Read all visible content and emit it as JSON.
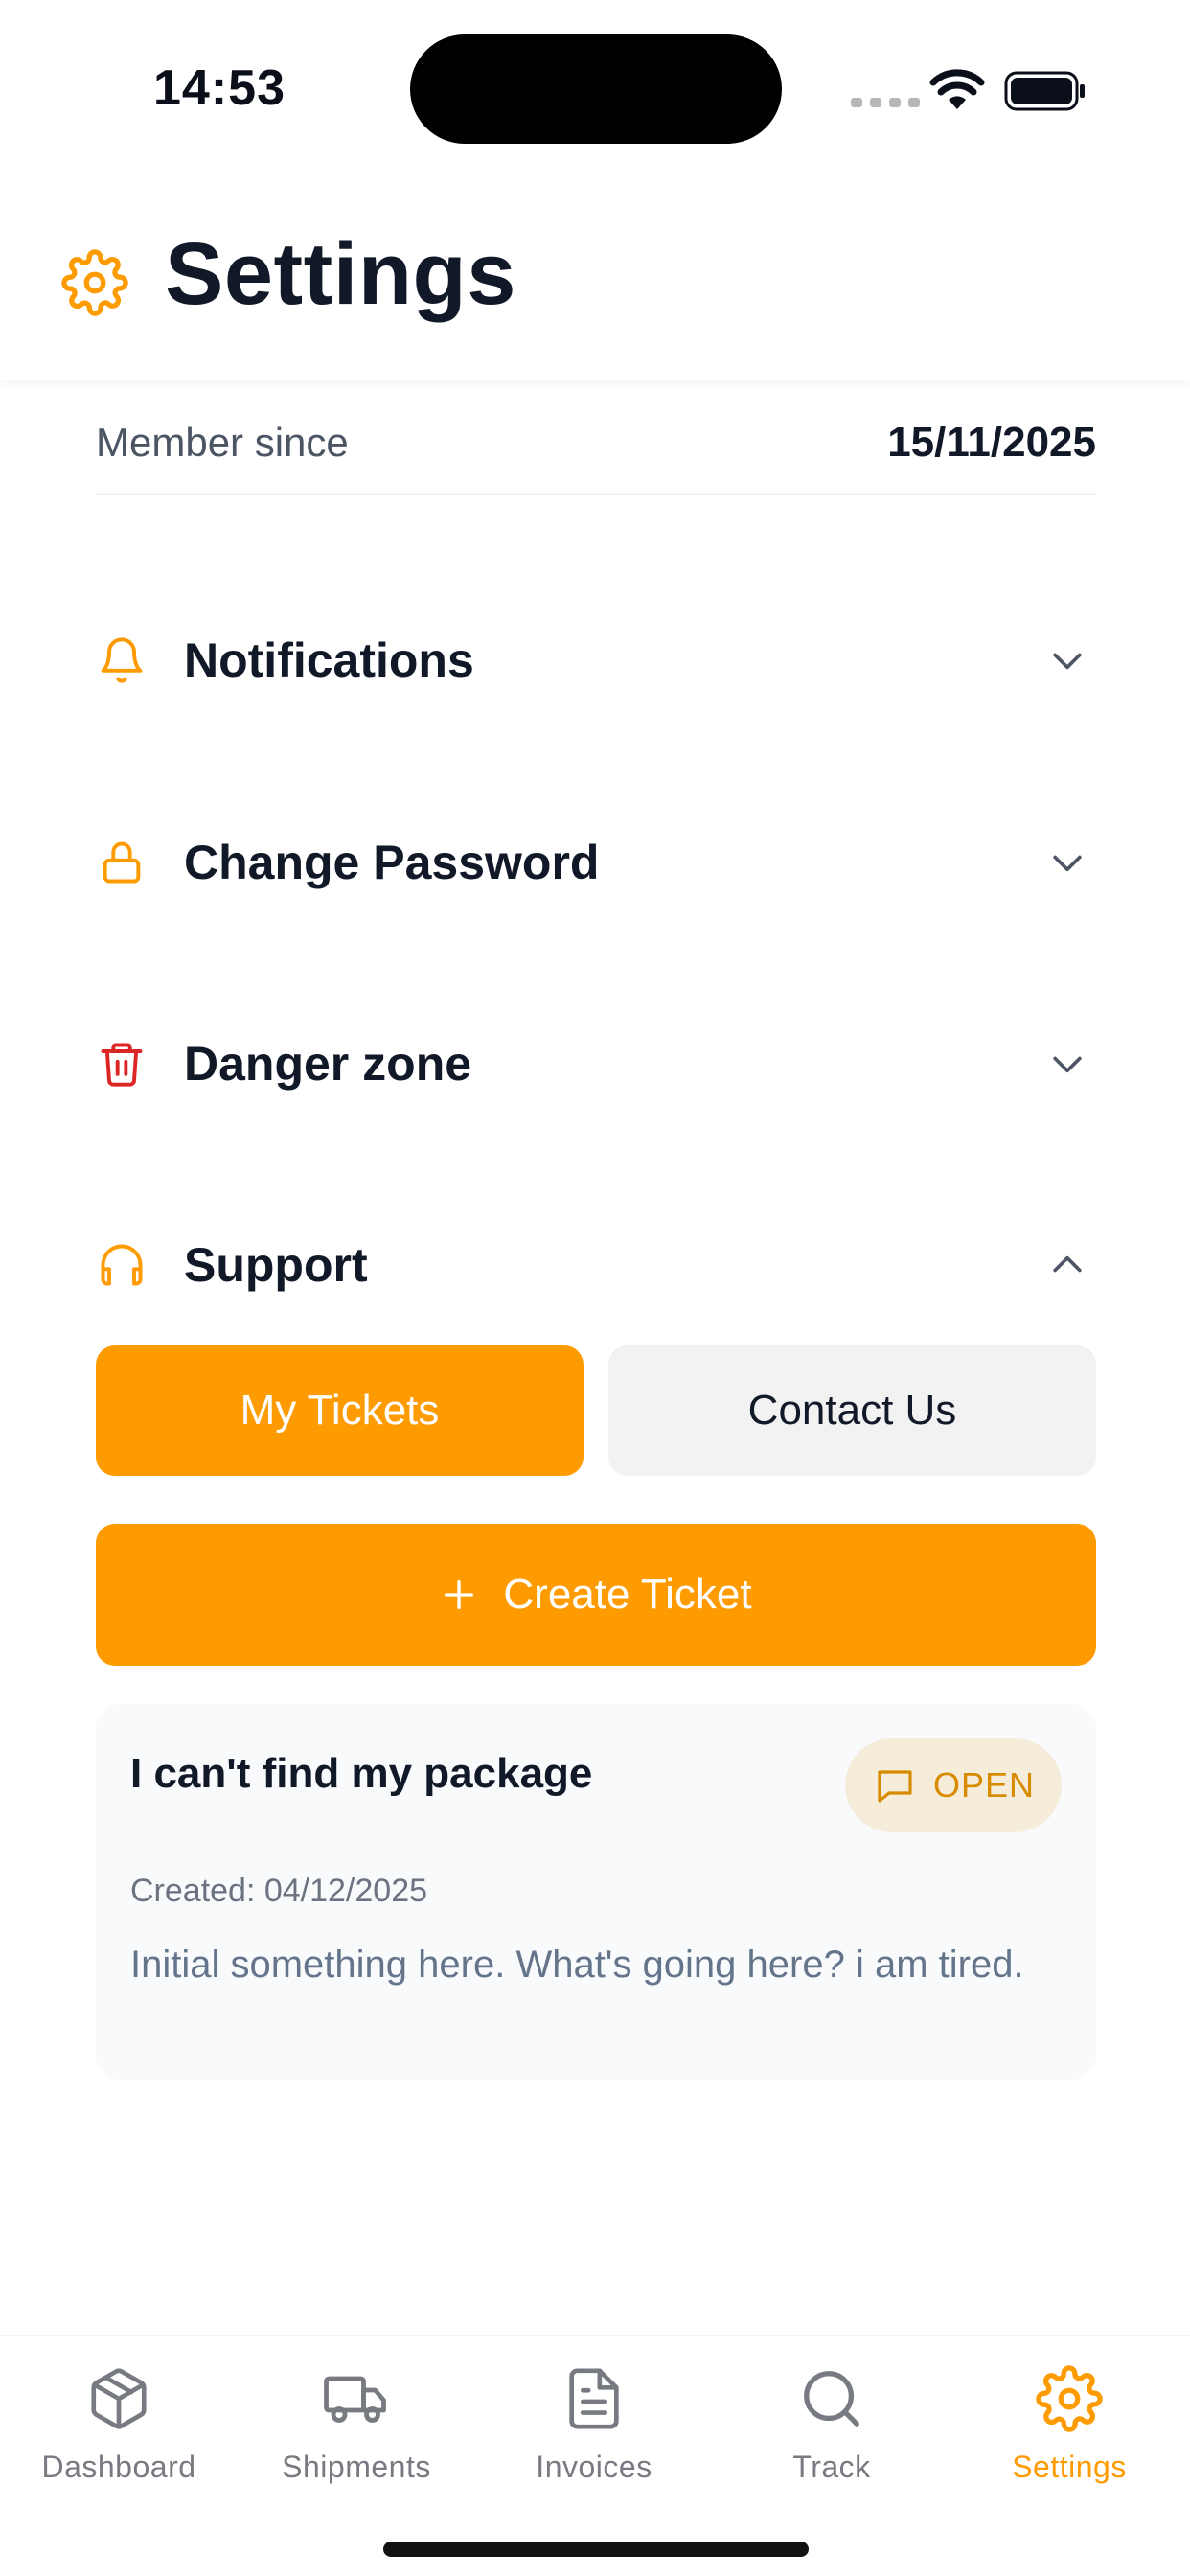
{
  "status_bar": {
    "time": "14:53"
  },
  "header": {
    "title": "Settings"
  },
  "member": {
    "label": "Member since",
    "value": "15/11/2025"
  },
  "sections": [
    {
      "label": "Notifications",
      "icon": "bell-icon",
      "expanded": false
    },
    {
      "label": "Change Password",
      "icon": "lock-icon",
      "expanded": false
    },
    {
      "label": "Danger zone",
      "icon": "trash-icon",
      "expanded": false
    },
    {
      "label": "Support",
      "icon": "headphones-icon",
      "expanded": true
    }
  ],
  "support": {
    "tabs": [
      {
        "label": "My Tickets",
        "active": true
      },
      {
        "label": "Contact Us",
        "active": false
      }
    ],
    "create_button": "Create Ticket",
    "tickets": [
      {
        "title": "I can't find my package",
        "status": "OPEN",
        "created": "Created: 04/12/2025",
        "description": "Initial something here. What's going here? i am tired."
      }
    ]
  },
  "bottom_nav": [
    {
      "label": "Dashboard",
      "icon": "package-icon",
      "active": false
    },
    {
      "label": "Shipments",
      "icon": "truck-icon",
      "active": false
    },
    {
      "label": "Invoices",
      "icon": "document-icon",
      "active": false
    },
    {
      "label": "Track",
      "icon": "search-icon",
      "active": false
    },
    {
      "label": "Settings",
      "icon": "gear-icon",
      "active": true
    }
  ],
  "colors": {
    "accent": "#fd9b00",
    "danger": "#dc2626",
    "text": "#111827",
    "muted": "#777a80"
  }
}
